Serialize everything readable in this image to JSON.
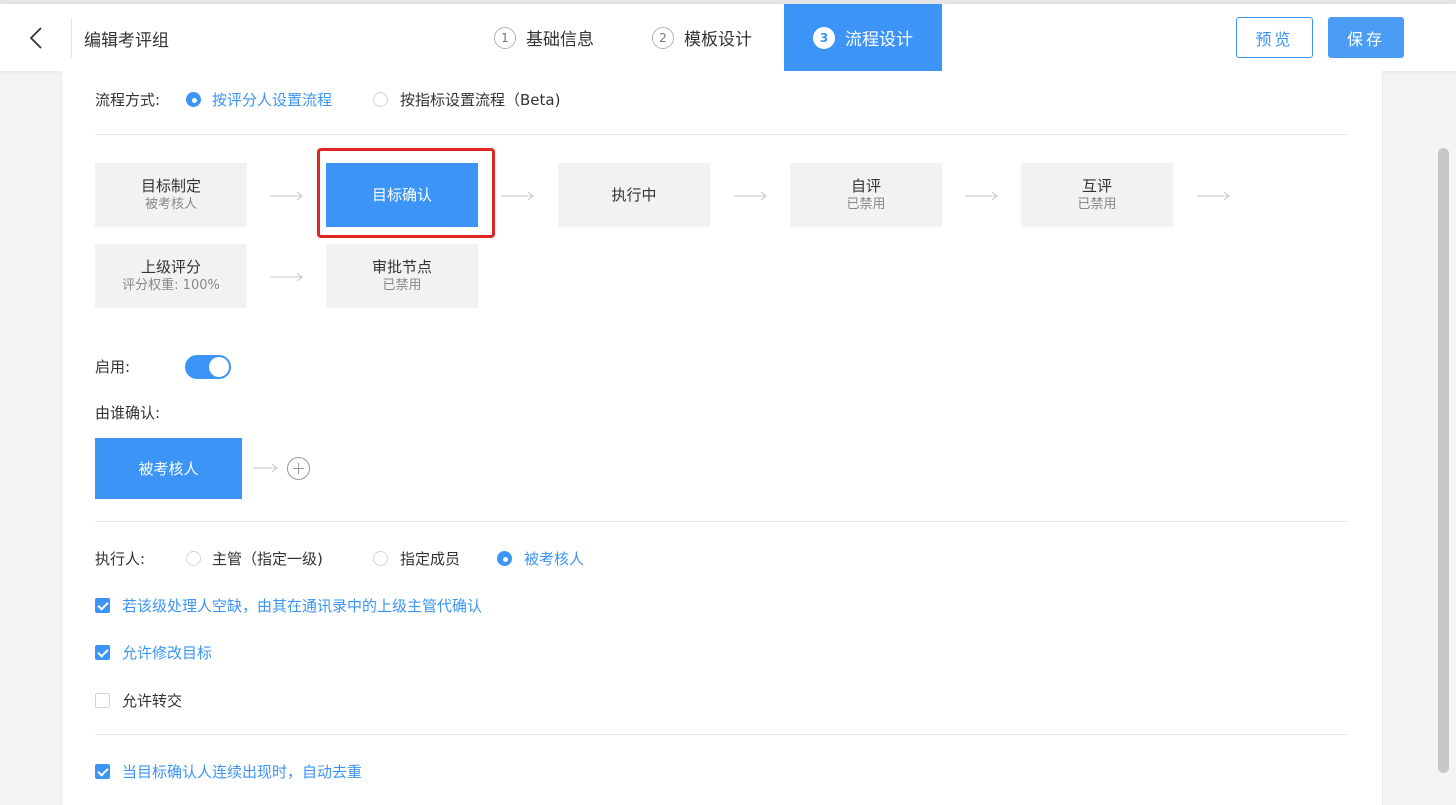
{
  "header": {
    "title": "编辑考评组",
    "steps": [
      {
        "num": "1",
        "label": "基础信息"
      },
      {
        "num": "2",
        "label": "模板设计"
      },
      {
        "num": "3",
        "label": "流程设计"
      }
    ],
    "preview_label": "预览",
    "save_label": "保存"
  },
  "flow_mode": {
    "label": "流程方式:",
    "options": [
      "按评分人设置流程",
      "按指标设置流程（Beta)"
    ],
    "selected_index": 0
  },
  "flow_nodes": [
    {
      "title": "目标制定",
      "sub": "被考核人"
    },
    {
      "title": "目标确认",
      "sub": ""
    },
    {
      "title": "执行中",
      "sub": ""
    },
    {
      "title": "自评",
      "sub": "已禁用"
    },
    {
      "title": "互评",
      "sub": "已禁用"
    },
    {
      "title": "上级评分",
      "sub": "评分权重: 100%"
    },
    {
      "title": "审批节点",
      "sub": "已禁用"
    }
  ],
  "enable": {
    "label": "启用:",
    "value": true
  },
  "confirm_by": {
    "label": "由谁确认:",
    "value": "被考核人"
  },
  "executor": {
    "label": "执行人:",
    "options": [
      "主管（指定一级)",
      "指定成员",
      "被考核人"
    ],
    "selected_index": 2
  },
  "checkboxes": [
    {
      "label": "若该级处理人空缺，由其在通讯录中的上级主管代确认",
      "checked": true
    },
    {
      "label": "允许修改目标",
      "checked": true
    },
    {
      "label": "允许转交",
      "checked": false
    }
  ],
  "dedupe": {
    "label": "当目标确认人连续出现时，自动去重",
    "checked": true
  },
  "colors": {
    "accent": "#3c95f6",
    "highlight": "#e02525"
  }
}
